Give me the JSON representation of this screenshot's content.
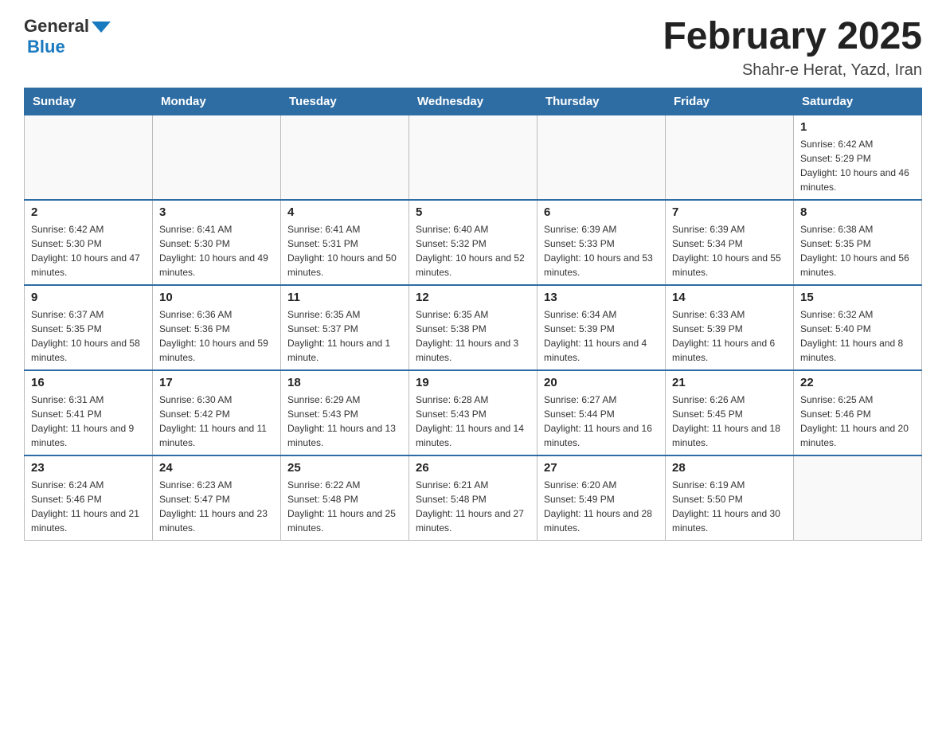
{
  "header": {
    "logo_general": "General",
    "logo_blue": "Blue",
    "title": "February 2025",
    "subtitle": "Shahr-e Herat, Yazd, Iran"
  },
  "days_of_week": [
    "Sunday",
    "Monday",
    "Tuesday",
    "Wednesday",
    "Thursday",
    "Friday",
    "Saturday"
  ],
  "weeks": [
    [
      {
        "day": "",
        "info": ""
      },
      {
        "day": "",
        "info": ""
      },
      {
        "day": "",
        "info": ""
      },
      {
        "day": "",
        "info": ""
      },
      {
        "day": "",
        "info": ""
      },
      {
        "day": "",
        "info": ""
      },
      {
        "day": "1",
        "info": "Sunrise: 6:42 AM\nSunset: 5:29 PM\nDaylight: 10 hours and 46 minutes."
      }
    ],
    [
      {
        "day": "2",
        "info": "Sunrise: 6:42 AM\nSunset: 5:30 PM\nDaylight: 10 hours and 47 minutes."
      },
      {
        "day": "3",
        "info": "Sunrise: 6:41 AM\nSunset: 5:30 PM\nDaylight: 10 hours and 49 minutes."
      },
      {
        "day": "4",
        "info": "Sunrise: 6:41 AM\nSunset: 5:31 PM\nDaylight: 10 hours and 50 minutes."
      },
      {
        "day": "5",
        "info": "Sunrise: 6:40 AM\nSunset: 5:32 PM\nDaylight: 10 hours and 52 minutes."
      },
      {
        "day": "6",
        "info": "Sunrise: 6:39 AM\nSunset: 5:33 PM\nDaylight: 10 hours and 53 minutes."
      },
      {
        "day": "7",
        "info": "Sunrise: 6:39 AM\nSunset: 5:34 PM\nDaylight: 10 hours and 55 minutes."
      },
      {
        "day": "8",
        "info": "Sunrise: 6:38 AM\nSunset: 5:35 PM\nDaylight: 10 hours and 56 minutes."
      }
    ],
    [
      {
        "day": "9",
        "info": "Sunrise: 6:37 AM\nSunset: 5:35 PM\nDaylight: 10 hours and 58 minutes."
      },
      {
        "day": "10",
        "info": "Sunrise: 6:36 AM\nSunset: 5:36 PM\nDaylight: 10 hours and 59 minutes."
      },
      {
        "day": "11",
        "info": "Sunrise: 6:35 AM\nSunset: 5:37 PM\nDaylight: 11 hours and 1 minute."
      },
      {
        "day": "12",
        "info": "Sunrise: 6:35 AM\nSunset: 5:38 PM\nDaylight: 11 hours and 3 minutes."
      },
      {
        "day": "13",
        "info": "Sunrise: 6:34 AM\nSunset: 5:39 PM\nDaylight: 11 hours and 4 minutes."
      },
      {
        "day": "14",
        "info": "Sunrise: 6:33 AM\nSunset: 5:39 PM\nDaylight: 11 hours and 6 minutes."
      },
      {
        "day": "15",
        "info": "Sunrise: 6:32 AM\nSunset: 5:40 PM\nDaylight: 11 hours and 8 minutes."
      }
    ],
    [
      {
        "day": "16",
        "info": "Sunrise: 6:31 AM\nSunset: 5:41 PM\nDaylight: 11 hours and 9 minutes."
      },
      {
        "day": "17",
        "info": "Sunrise: 6:30 AM\nSunset: 5:42 PM\nDaylight: 11 hours and 11 minutes."
      },
      {
        "day": "18",
        "info": "Sunrise: 6:29 AM\nSunset: 5:43 PM\nDaylight: 11 hours and 13 minutes."
      },
      {
        "day": "19",
        "info": "Sunrise: 6:28 AM\nSunset: 5:43 PM\nDaylight: 11 hours and 14 minutes."
      },
      {
        "day": "20",
        "info": "Sunrise: 6:27 AM\nSunset: 5:44 PM\nDaylight: 11 hours and 16 minutes."
      },
      {
        "day": "21",
        "info": "Sunrise: 6:26 AM\nSunset: 5:45 PM\nDaylight: 11 hours and 18 minutes."
      },
      {
        "day": "22",
        "info": "Sunrise: 6:25 AM\nSunset: 5:46 PM\nDaylight: 11 hours and 20 minutes."
      }
    ],
    [
      {
        "day": "23",
        "info": "Sunrise: 6:24 AM\nSunset: 5:46 PM\nDaylight: 11 hours and 21 minutes."
      },
      {
        "day": "24",
        "info": "Sunrise: 6:23 AM\nSunset: 5:47 PM\nDaylight: 11 hours and 23 minutes."
      },
      {
        "day": "25",
        "info": "Sunrise: 6:22 AM\nSunset: 5:48 PM\nDaylight: 11 hours and 25 minutes."
      },
      {
        "day": "26",
        "info": "Sunrise: 6:21 AM\nSunset: 5:48 PM\nDaylight: 11 hours and 27 minutes."
      },
      {
        "day": "27",
        "info": "Sunrise: 6:20 AM\nSunset: 5:49 PM\nDaylight: 11 hours and 28 minutes."
      },
      {
        "day": "28",
        "info": "Sunrise: 6:19 AM\nSunset: 5:50 PM\nDaylight: 11 hours and 30 minutes."
      },
      {
        "day": "",
        "info": ""
      }
    ]
  ]
}
